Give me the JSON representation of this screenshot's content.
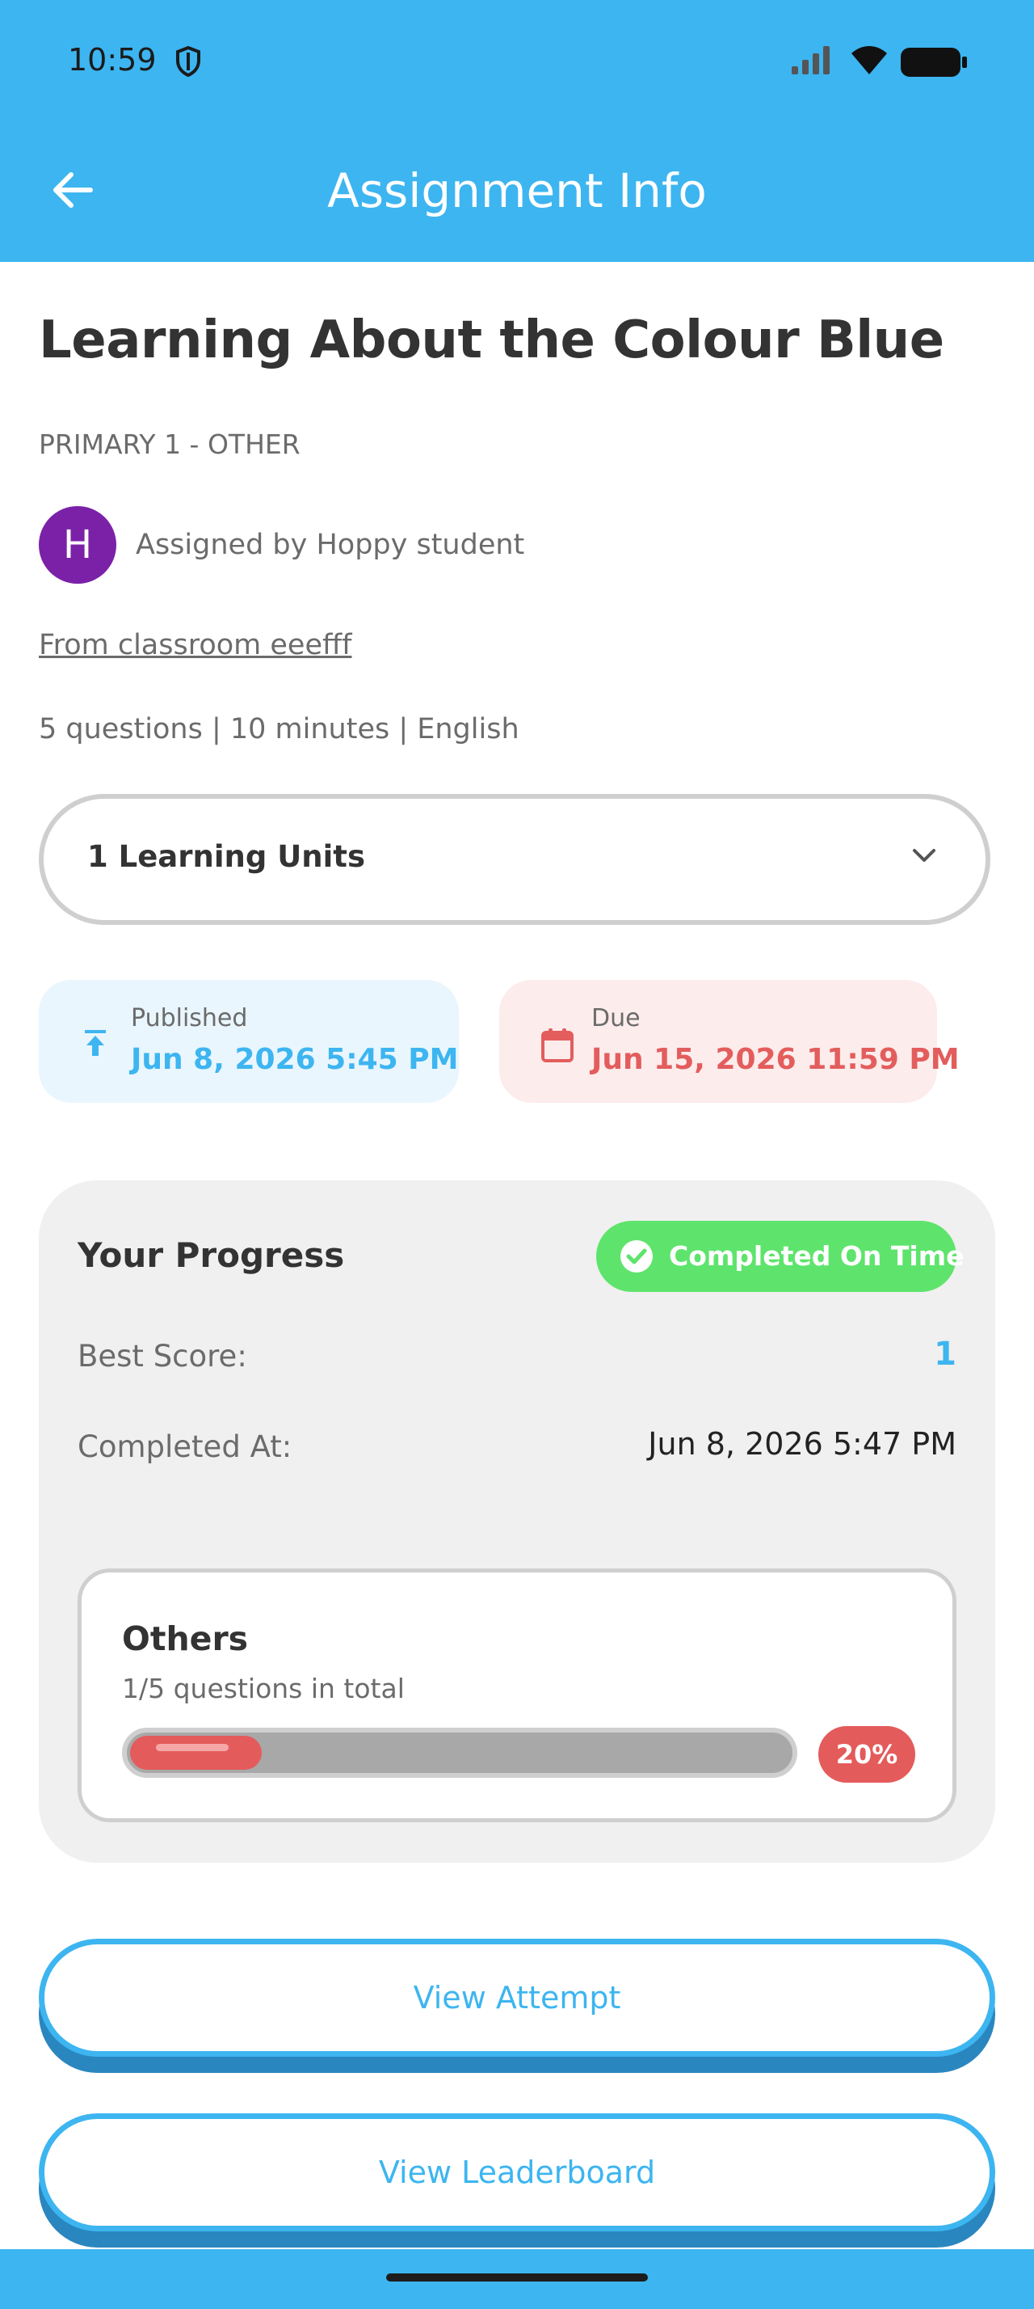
{
  "status_bar": {
    "time": "10:59"
  },
  "app_bar": {
    "title": "Assignment Info"
  },
  "assignment": {
    "title": "Learning About the Colour Blue",
    "subject": "PRIMARY 1 - OTHER",
    "avatar_letter": "H",
    "assigned_by": "Assigned by Hoppy student",
    "classroom_link": "From classroom eeefff",
    "meta": "5 questions | 10 minutes | English"
  },
  "learning_units": {
    "label": "1 Learning Units"
  },
  "published": {
    "label": "Published",
    "date": "Jun 8, 2026 5:45 PM"
  },
  "due": {
    "label": "Due",
    "date": "Jun 15, 2026 11:59 PM"
  },
  "progress": {
    "title": "Your Progress",
    "status_badge": "Completed On Time",
    "best_score_label": "Best Score:",
    "best_score_value": "1",
    "completed_at_label": "Completed At:",
    "completed_at_value": "Jun 8, 2026 5:47 PM",
    "category": {
      "title": "Others",
      "subtitle": "1/5 questions in total",
      "percent_label": "20%",
      "fraction": 0.2
    }
  },
  "actions": {
    "view_attempt": "View Attempt",
    "view_leaderboard": "View Leaderboard"
  },
  "colors": {
    "primary": "#3db5f0",
    "success": "#5ee46c",
    "danger": "#e45b5b",
    "avatar": "#7b21a8"
  }
}
